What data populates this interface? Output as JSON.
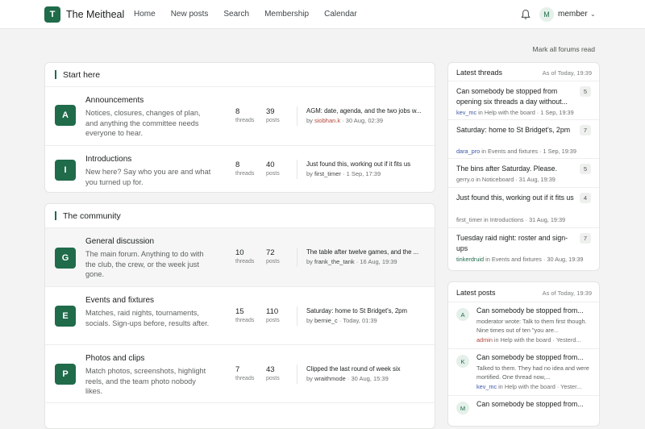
{
  "brand": {
    "logo_letter": "T",
    "name": "The Meitheal"
  },
  "nav": [
    "Home",
    "New posts",
    "Search",
    "Membership",
    "Calendar"
  ],
  "user": {
    "avatar": "M",
    "name": "member"
  },
  "mark_all": "Mark all forums read",
  "sections": [
    {
      "title": "Start here",
      "forums": [
        {
          "letter": "A",
          "name": "Announcements",
          "desc": "Notices, closures, changes of plan, and anything the committee needs everyone to hear.",
          "threads": "8",
          "posts": "39",
          "last_title": "AGM: date, agenda, and the two jobs w...",
          "last_by": "siobhan.k",
          "last_when": "30 Aug, 02:39"
        },
        {
          "letter": "I",
          "name": "Introductions",
          "desc": "New here? Say who you are and what you turned up for.",
          "threads": "8",
          "posts": "40",
          "last_title": "Just found this, working out if it fits us",
          "last_by": "first_timer",
          "last_when": "1 Sep, 17:39"
        }
      ]
    },
    {
      "title": "The community",
      "forums": [
        {
          "letter": "G",
          "name": "General discussion",
          "desc": "The main forum. Anything to do with the club, the crew, or the week just gone.",
          "threads": "10",
          "posts": "72",
          "last_title": "The table after twelve games, and the ...",
          "last_by": "frank_the_tank",
          "last_when": "16 Aug, 19:39"
        },
        {
          "letter": "E",
          "name": "Events and fixtures",
          "desc": "Matches, raid nights, tournaments, socials. Sign-ups before, results after.",
          "threads": "15",
          "posts": "110",
          "last_title": "Saturday: home to St Bridget's, 2pm",
          "last_by": "bernie_c",
          "last_when": "Today, 01:39"
        },
        {
          "letter": "P",
          "name": "Photos and clips",
          "desc": "Match photos, screenshots, highlight reels, and the team photo nobody likes.",
          "threads": "7",
          "posts": "43",
          "last_title": "Clipped the last round of week six",
          "last_by": "wraithmode",
          "last_when": "30 Aug, 15:39"
        }
      ]
    }
  ],
  "labels": {
    "threads": "threads",
    "posts": "posts",
    "by": "by",
    "in": "in"
  },
  "latest_threads": {
    "title": "Latest threads",
    "asof": "As of Today, 19:39",
    "items": [
      {
        "title": "Can somebody be stopped from opening six threads a day without...",
        "user": "kev_mc",
        "forum": "Help with the board",
        "when": "1 Sep, 19:39",
        "count": "5"
      },
      {
        "title": "Saturday: home to St Bridget's, 2pm",
        "user": "dara_pro",
        "forum": "Events and fixtures",
        "when": "1 Sep, 19:39",
        "count": "7"
      },
      {
        "title": "The bins after Saturday. Please.",
        "user": "gerry.o",
        "forum": "Noticeboard",
        "when": "31 Aug, 19:39",
        "count": "5"
      },
      {
        "title": "Just found this, working out if it fits us",
        "user": "first_timer",
        "forum": "Introductions",
        "when": "31 Aug, 19:39",
        "count": "4"
      },
      {
        "title": "Tuesday raid night: roster and sign-ups",
        "user": "tinkerdruid",
        "forum": "Events and fixtures",
        "when": "30 Aug, 19:39",
        "count": "7"
      }
    ]
  },
  "latest_posts": {
    "title": "Latest posts",
    "asof": "As of Today, 19:39",
    "items": [
      {
        "avatar": "A",
        "title": "Can somebody be stopped from...",
        "excerpt": "moderator wrote: Talk to them first though. Nine times out of ten \"you are...",
        "user": "admin",
        "forum": "Help with the board",
        "when": "Yesterd..."
      },
      {
        "avatar": "K",
        "title": "Can somebody be stopped from...",
        "excerpt": "Talked to them. They had no idea and were mortified. One thread now,...",
        "user": "kev_mc",
        "forum": "Help with the board",
        "when": "Yester..."
      },
      {
        "avatar": "M",
        "title": "Can somebody be stopped from..."
      }
    ]
  },
  "colors": {
    "accent": "#1f6b4a",
    "username_red": "#b2453c",
    "username_blue": "#3a57a8"
  }
}
